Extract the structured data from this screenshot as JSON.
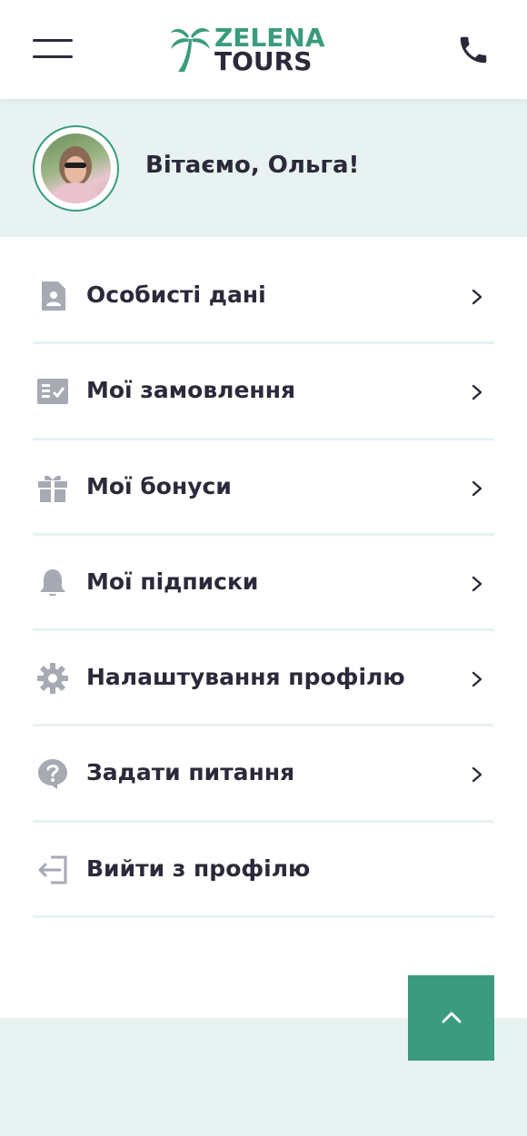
{
  "header": {
    "logo_line1": "ZELENA",
    "logo_line2": "TOURS",
    "brand_color": "#3a9b7e",
    "icons": {
      "menu": "hamburger-icon",
      "phone": "phone-icon",
      "logo": "palm-tree-icon"
    }
  },
  "welcome": {
    "greeting": "Вітаємо, Ольга!",
    "avatar_icon": "avatar"
  },
  "menu": {
    "items": [
      {
        "label": "Особисті дані",
        "icon": "person-card-icon"
      },
      {
        "label": "Мої замовлення",
        "icon": "checklist-icon"
      },
      {
        "label": "Мої бонуси",
        "icon": "gift-icon"
      },
      {
        "label": "Мої підписки",
        "icon": "bell-icon"
      },
      {
        "label": "Налаштування профілю",
        "icon": "gear-icon"
      },
      {
        "label": "Задати питання",
        "icon": "question-icon"
      },
      {
        "label": "Вийти з профілю",
        "icon": "logout-icon"
      }
    ]
  },
  "scroll_top": {
    "icon": "chevron-up-icon"
  }
}
